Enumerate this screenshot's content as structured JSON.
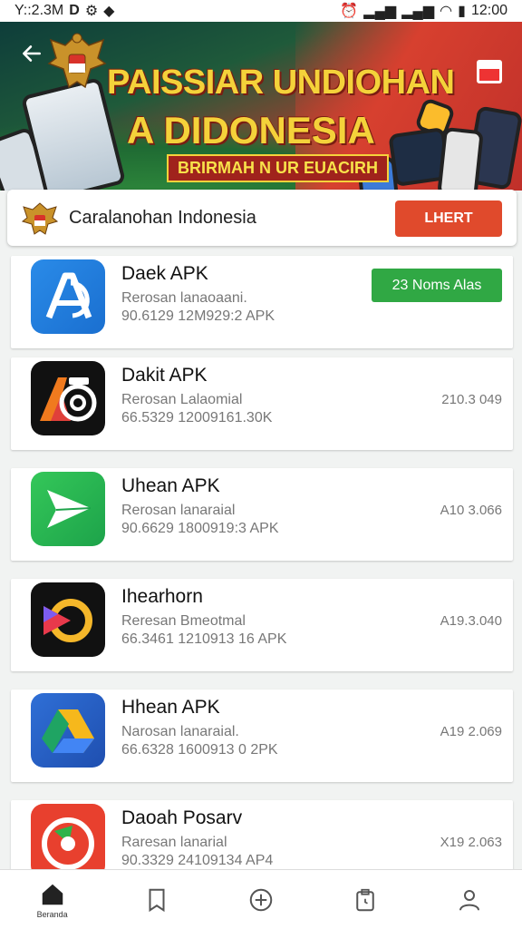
{
  "status_bar": {
    "time": "Y::2.3M",
    "left_icons": "D",
    "clock": "12:00"
  },
  "banner": {
    "title_line1": "PAISSIAR UNDIOHAN",
    "title_line2": "A DIDONESIA",
    "subtitle": "BRIRMAH N UR EUACIRH"
  },
  "header": {
    "title": "Caralanohan Indonesia",
    "button_label": "LHERT"
  },
  "apps": [
    {
      "name": "Daek APK",
      "subtitle": "Rerosan lanaoaani.",
      "meta": "90.6129 12M929:2 APK",
      "badge": "23 Noms Alas",
      "icon": "app-a-icon"
    },
    {
      "name": "Dakit APK",
      "subtitle": "Rerosan Lalaomial",
      "meta": "66.5329 12009161.30K",
      "size": "210.3 049",
      "icon": "camera-app-icon"
    },
    {
      "name": "Uhean APK",
      "subtitle": "Rerosan lanaraial",
      "meta": "90.6629 1800919:3 APK",
      "size": "A10 3.066",
      "icon": "send-app-icon"
    },
    {
      "name": "Ihearhorn",
      "subtitle": "Reresan Bmeotmal",
      "meta": "66.3461 1210913 16 APK",
      "size": "A19.3.040",
      "icon": "play-app-icon"
    },
    {
      "name": "Hhean APK",
      "subtitle": "Narosan lanaraial.",
      "meta": "66.6328 1600913 0 2PK",
      "size": "A19 2.069",
      "icon": "drive-app-icon"
    },
    {
      "name": "Daoah Posarv",
      "subtitle": "Raresan lanarial",
      "meta": "90.3329 24109134 AP4",
      "size": "X19 2.063",
      "icon": "pin-app-icon"
    }
  ],
  "bottom_nav": {
    "home_label": "Beranda",
    "items": [
      "home-icon",
      "bookmark-icon",
      "plus-circle-icon",
      "clipboard-clock-icon",
      "profile-icon"
    ]
  }
}
